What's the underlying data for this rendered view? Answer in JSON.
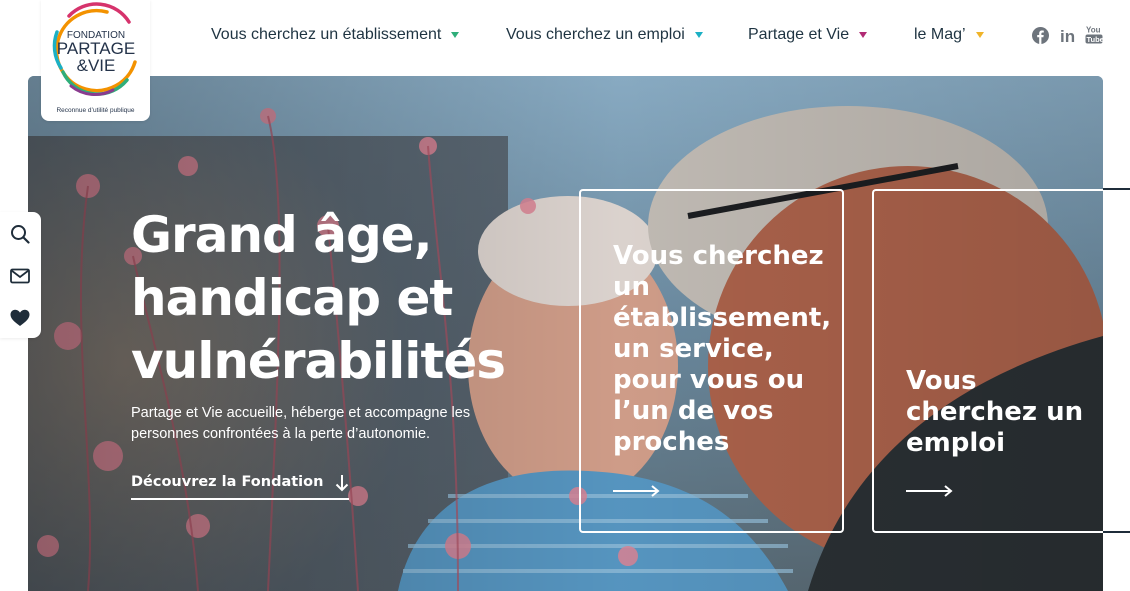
{
  "logo": {
    "line1": "FONDATION",
    "line2": "PARTAGE",
    "line3": "&VIE",
    "tagline": "Reconnue d’utilité publique"
  },
  "nav": {
    "items": [
      {
        "label": "Vous cherchez un établissement",
        "caret_color": "#2fae7a"
      },
      {
        "label": "Vous cherchez un emploi",
        "caret_color": "#1bb0c4"
      },
      {
        "label": "Partage et Vie",
        "caret_color": "#b12a74"
      },
      {
        "label": "le Mag’",
        "caret_color": "#f0b429"
      }
    ]
  },
  "social": [
    {
      "icon": "facebook-icon"
    },
    {
      "icon": "linkedin-icon",
      "text": "in"
    },
    {
      "icon": "youtube-icon",
      "text_top": "You",
      "text_bottom": "Tube"
    }
  ],
  "sidebar": [
    {
      "icon": "search-icon"
    },
    {
      "icon": "mail-icon"
    },
    {
      "icon": "heart-icon"
    }
  ],
  "hero": {
    "title_line1": "Grand âge,",
    "title_line2": "handicap et",
    "title_line3": "vulnérabilités",
    "subtitle": "Partage et Vie accueille, héberge et accompagne les personnes confrontées à la perte d’autonomie.",
    "link_label": "Découvrez la Fondation"
  },
  "cards": [
    {
      "text": "Vous cherchez un établissement, un service, pour vous ou l’un de vos proches"
    },
    {
      "text": "Vous cherchez un emploi"
    }
  ],
  "colors": {
    "text_dark": "#1f3442",
    "white": "#ffffff",
    "logo_orange": "#f39200",
    "logo_green": "#2fae7a",
    "logo_pink": "#d6336c",
    "logo_teal": "#1bb0c4"
  }
}
